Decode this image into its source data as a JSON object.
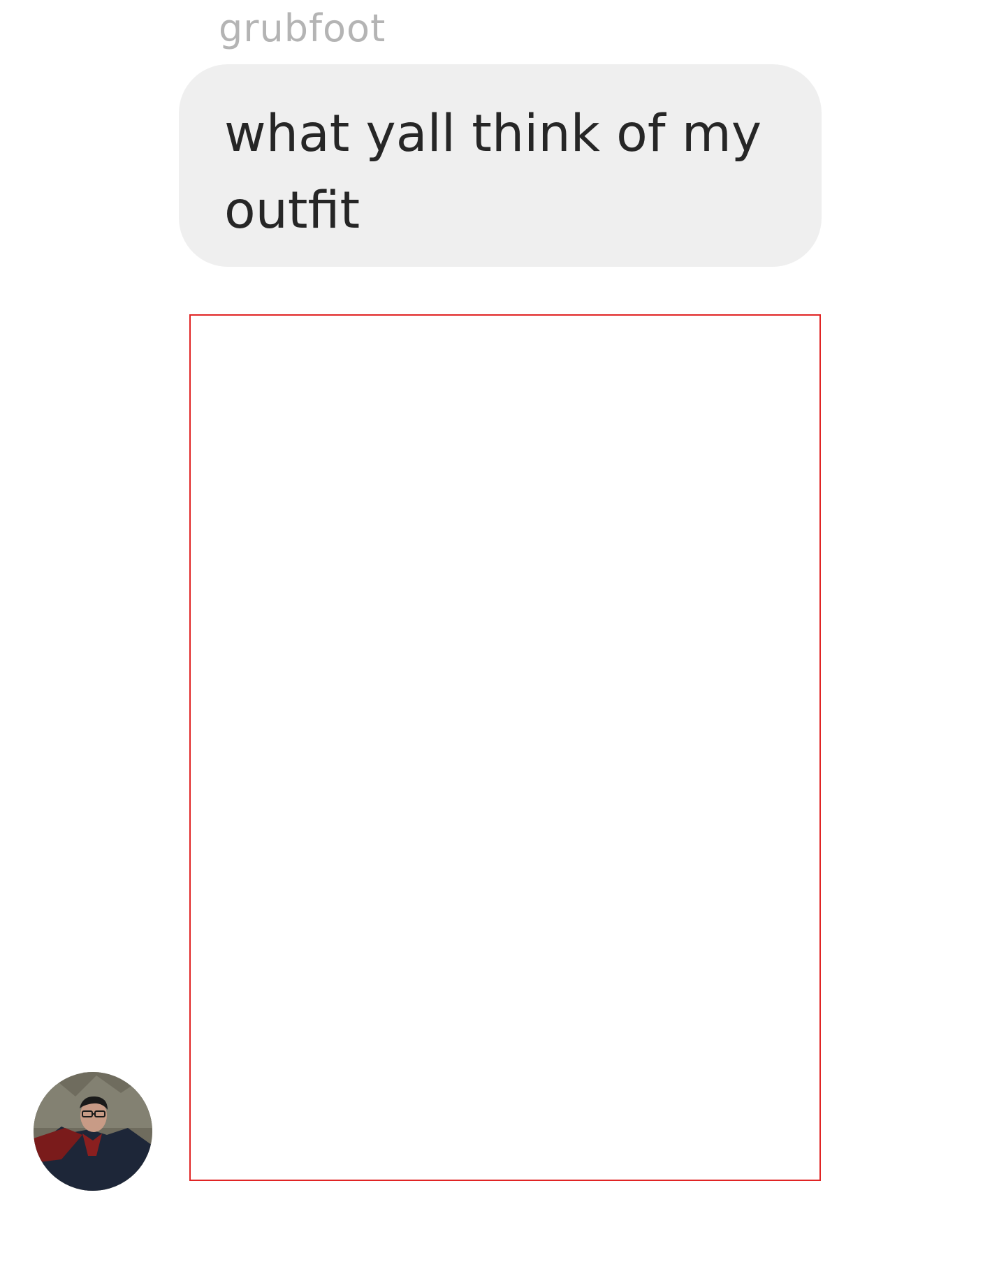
{
  "message": {
    "sender": "grubfoot",
    "text": "what yall think of my outfit"
  },
  "attachment": {
    "type": "image",
    "border_color": "#e02424"
  },
  "avatar": {
    "icon": "profile-photo"
  },
  "colors": {
    "bubble": "#efefef",
    "sender_name": "#b4b4b4",
    "message_text": "#262626"
  }
}
